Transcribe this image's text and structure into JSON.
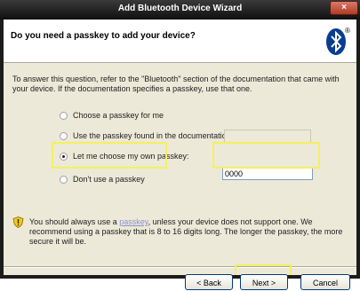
{
  "window": {
    "title": "Add Bluetooth Device Wizard",
    "close_symbol": "×"
  },
  "header": {
    "title": "Do you need a passkey to add your device?",
    "logo_icon": "bluetooth-icon",
    "logo_registered": "®"
  },
  "description": "To answer this question, refer to the \"Bluetooth\" section of the documentation that came with your device. If the documentation specifies a passkey, use that one.",
  "options": [
    {
      "label": "Choose a passkey for me",
      "checked": false
    },
    {
      "label": "Use the passkey found in the documentation:",
      "checked": false
    },
    {
      "label": "Let me choose my own passkey:",
      "checked": true
    },
    {
      "label": "Don't use a passkey",
      "checked": false
    }
  ],
  "passkey_input": {
    "value": "0000"
  },
  "note": {
    "prefix": "You should always use a ",
    "link": "passkey",
    "suffix": ", unless your device does not support one. We recommend using a passkey that is 8 to 16 digits long. The longer the passkey, the more secure it will be.",
    "icon": "shield-warning-icon"
  },
  "buttons": {
    "back": "< Back",
    "next": "Next >",
    "cancel": "Cancel"
  },
  "colors": {
    "highlight": "#f4f060",
    "bluetooth_blue": "#0a3d91"
  }
}
